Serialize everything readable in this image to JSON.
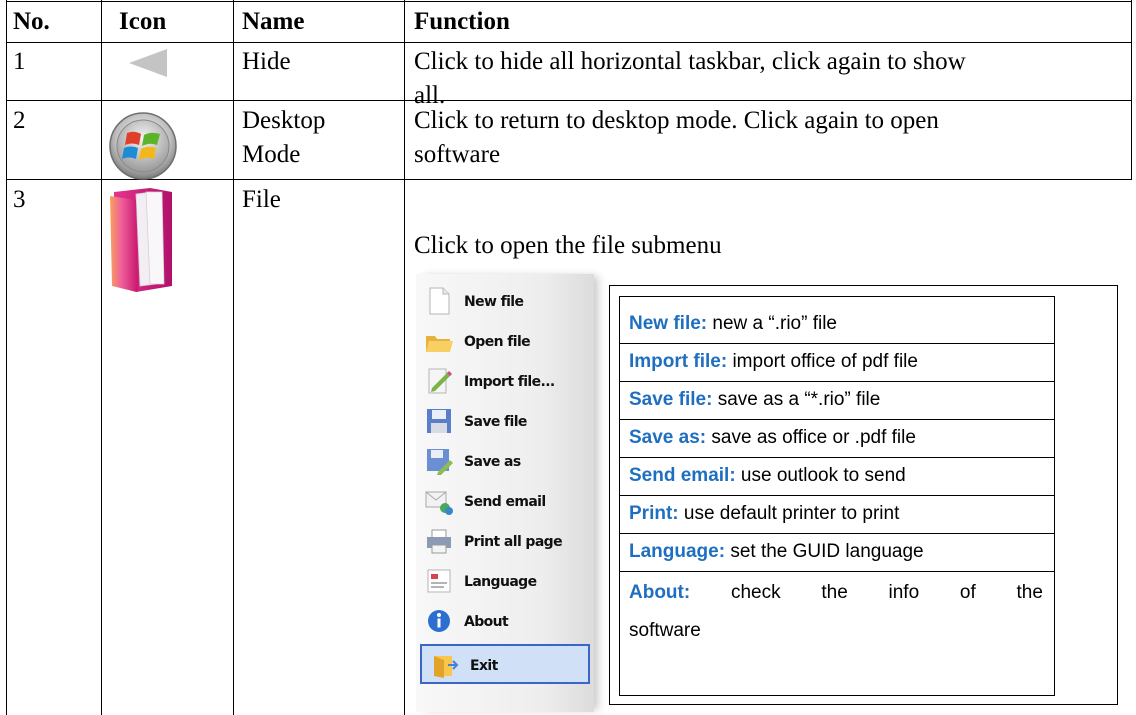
{
  "table": {
    "headers": {
      "no": "No.",
      "icon": "Icon",
      "name": "Name",
      "function": "Function"
    },
    "rows": [
      {
        "no": "1",
        "name": "Hide",
        "function_line1": "Click to hide all horizontal taskbar, click again to show",
        "function_line2": "all.",
        "icon": "triangle-left-icon"
      },
      {
        "no": "2",
        "name_line1": "Desktop",
        "name_line2": "Mode",
        "function_line1": "Click to return to desktop mode. Click again to open",
        "function_line2": "software",
        "icon": "windows-orb-icon"
      },
      {
        "no": "3",
        "name": "File",
        "function_line1": "Click to open the file submenu",
        "icon": "folder-icon"
      }
    ]
  },
  "submenu": {
    "items": [
      {
        "label": "New file",
        "icon": "new-file-icon"
      },
      {
        "label": "Open file",
        "icon": "open-folder-icon"
      },
      {
        "label": "Import file...",
        "icon": "import-icon"
      },
      {
        "label": "Save file",
        "icon": "floppy-icon"
      },
      {
        "label": "Save as",
        "icon": "save-as-icon"
      },
      {
        "label": "Send email",
        "icon": "email-icon"
      },
      {
        "label": "Print all page",
        "icon": "printer-icon"
      },
      {
        "label": "Language",
        "icon": "language-icon"
      },
      {
        "label": "About",
        "icon": "info-icon"
      },
      {
        "label": "Exit",
        "icon": "exit-icon",
        "selected": true
      }
    ]
  },
  "descriptions": [
    {
      "term": "New file:",
      "text": " new a “.rio” file"
    },
    {
      "term": "Import file:",
      "text": " import office of pdf file"
    },
    {
      "term": "Save file:",
      "text": " save as a “*.rio” file"
    },
    {
      "term": "Save as:",
      "text": " save as office or .pdf file"
    },
    {
      "term": "Send email:",
      "text": " use outlook to send"
    },
    {
      "term": "Print:",
      "text": " use default printer to print"
    },
    {
      "term": "Language:",
      "text": " set the GUID language"
    }
  ],
  "about": {
    "term": "About:",
    "words": [
      "check",
      "the",
      "info",
      "of",
      "the"
    ],
    "line2": "software"
  },
  "colors": {
    "term": "#1f6fc1",
    "selection_border": "#3a66c9",
    "selection_fill": "#cfe0f7"
  }
}
